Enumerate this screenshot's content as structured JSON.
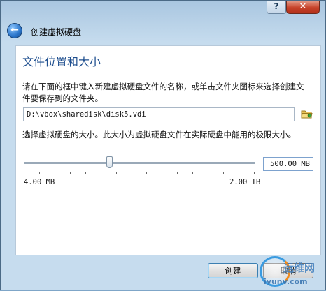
{
  "window": {
    "help_label": "?",
    "close_label": "✕"
  },
  "header": {
    "back_icon": "back-arrow-icon",
    "title": "创建虚拟硬盘"
  },
  "section": {
    "title": "文件位置和大小",
    "location_desc": "请在下面的框中键入新建虚拟硬盘文件的名称，或单击文件夹图标来选择创建文件要保存到的文件夹。",
    "size_desc": "选择虚拟硬盘的大小。此大小为虚拟硬盘文件在实际硬盘中能用的极限大小。"
  },
  "location": {
    "path": "D:\\vbox\\sharedisk\\disk5.vdi",
    "folder_icon": "folder-icon"
  },
  "size": {
    "value": "500.00 MB",
    "min_label": "4.00 MB",
    "max_label": "2.00 TB",
    "slider_fraction": 0.37
  },
  "buttons": {
    "create": "创建",
    "cancel": "取消"
  },
  "watermark": {
    "text1": "运维网",
    "text2": "iyunv.com"
  },
  "colors": {
    "title_blue": "#1f4f8f",
    "frame": "#c6dcee"
  }
}
